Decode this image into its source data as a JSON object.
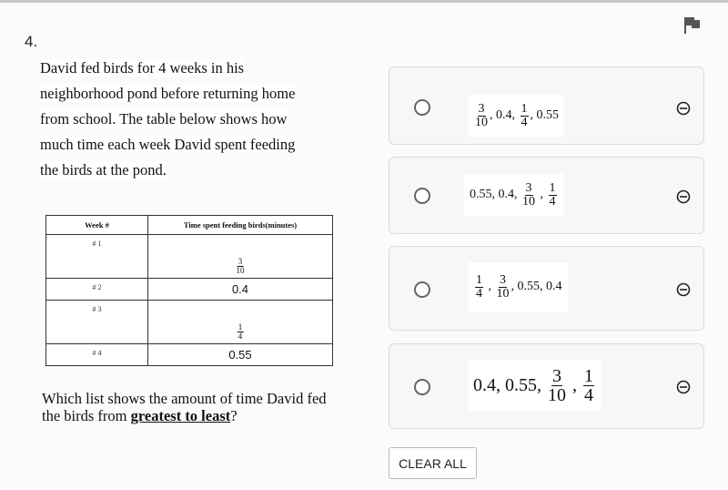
{
  "question": {
    "number": "4.",
    "stem_lines": [
      "David fed birds for 4 weeks in his",
      "neighborhood pond before returning home",
      "from school.  The table below shows how",
      "much time each week David spent feeding",
      "the birds at the pond."
    ],
    "prompt_before": "Which list shows the amount of time David fed the birds from ",
    "prompt_emphasis": "greatest to least",
    "prompt_after": "?"
  },
  "table": {
    "headers": [
      "Week #",
      "Time spent feeding birds(minutes)"
    ],
    "rows": [
      {
        "week": "# 1",
        "num": "3",
        "den": "10"
      },
      {
        "week": "# 2",
        "value": "0.4"
      },
      {
        "week": "# 3",
        "num": "1",
        "den": "4"
      },
      {
        "week": "# 4",
        "value": "0.55"
      }
    ]
  },
  "options": [
    {
      "parts": [
        {
          "num": "3",
          "den": "10"
        },
        ", 0.4, ",
        {
          "num": "1",
          "den": "4"
        },
        ", 0.55"
      ]
    },
    {
      "parts": [
        "0.55, 0.4, ",
        {
          "num": "3",
          "den": "10"
        },
        " , ",
        {
          "num": "1",
          "den": "4"
        }
      ]
    },
    {
      "parts": [
        {
          "num": "1",
          "den": "4"
        },
        " , ",
        {
          "num": "3",
          "den": "10"
        },
        ", 0.55, 0.4"
      ]
    },
    {
      "parts": [
        "0.4, 0.55, ",
        {
          "num": "3",
          "den": "10"
        },
        " , ",
        {
          "num": "1",
          "den": "4"
        }
      ]
    }
  ],
  "icons": {
    "flag": "flag-icon",
    "radio": "radio-unselected-icon",
    "eliminate": "eliminate-circle-minus-icon"
  },
  "buttons": {
    "clear_all": "CLEAR ALL"
  }
}
